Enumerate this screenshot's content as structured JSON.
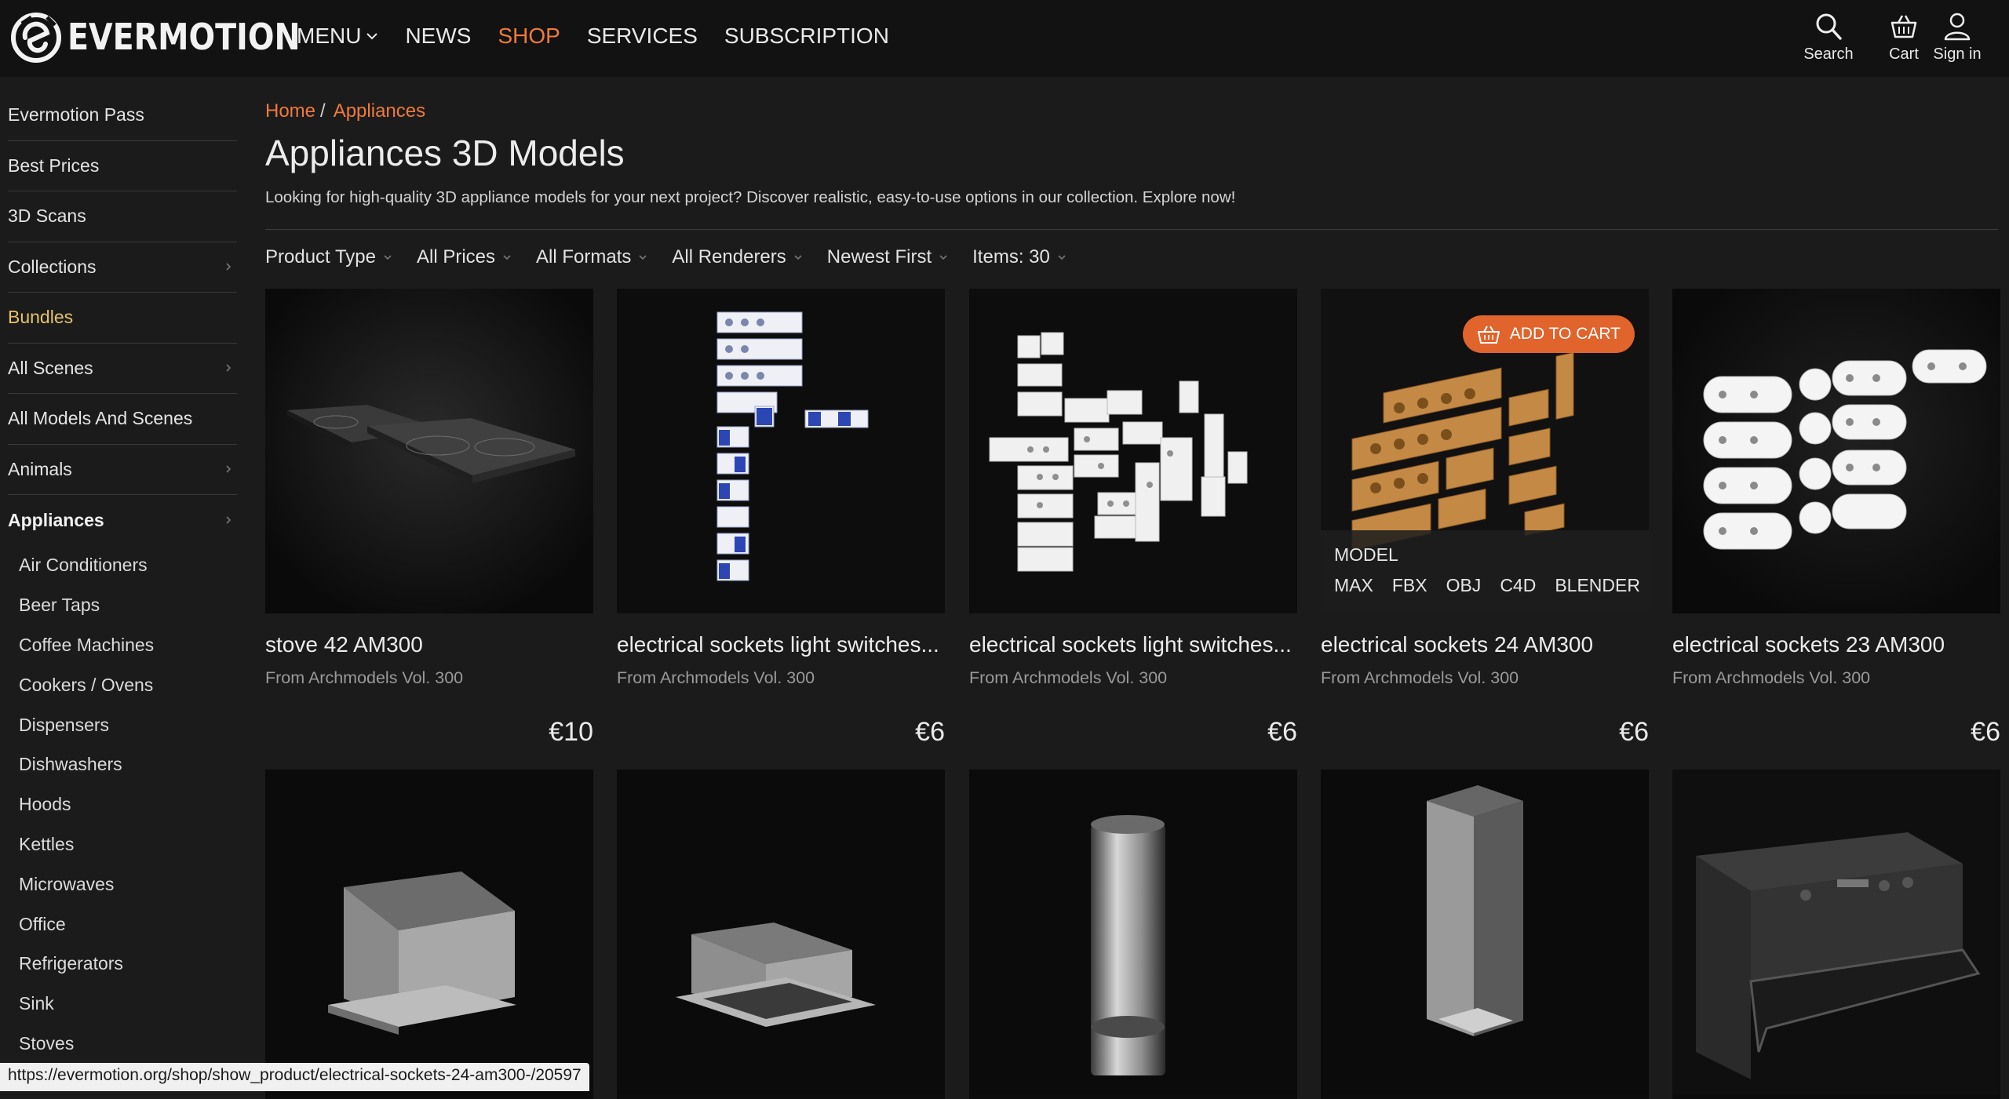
{
  "brand": {
    "name": "EVERMOTION"
  },
  "nav": {
    "items": [
      {
        "label": "MENU",
        "dropdown": true,
        "active": false
      },
      {
        "label": "NEWS",
        "active": false
      },
      {
        "label": "SHOP",
        "active": true
      },
      {
        "label": "SERVICES",
        "active": false
      },
      {
        "label": "SUBSCRIPTION",
        "active": false
      }
    ],
    "search_label": "Search",
    "cart_label": "Cart",
    "signin_label": "Sign in"
  },
  "sidebar": {
    "items": [
      {
        "label": "Evermotion Pass"
      },
      {
        "label": "Best Prices"
      },
      {
        "label": "3D Scans"
      },
      {
        "label": "Collections",
        "has_children": true
      },
      {
        "label": "Bundles",
        "highlight": true
      },
      {
        "label": "All Scenes",
        "has_children": true
      },
      {
        "label": "All Models And Scenes"
      },
      {
        "label": "Animals",
        "has_children": true
      },
      {
        "label": "Appliances",
        "has_children": true,
        "selected": true
      }
    ],
    "subcategories": [
      "Air Conditioners",
      "Beer Taps",
      "Coffee Machines",
      "Cookers / Ovens",
      "Dispensers",
      "Dishwashers",
      "Hoods",
      "Kettles",
      "Microwaves",
      "Office",
      "Refrigerators",
      "Sink",
      "Stoves"
    ]
  },
  "breadcrumb": {
    "home": "Home",
    "separator": "/",
    "current": "Appliances"
  },
  "page": {
    "title": "Appliances 3D Models",
    "description": "Looking for high-quality 3D appliance models for your next project? Discover realistic, easy-to-use options in our collection. Explore now!"
  },
  "filters": [
    "Product Type",
    "All Prices",
    "All Formats",
    "All Renderers",
    "Newest First",
    "Items: 30"
  ],
  "products": [
    {
      "title": "stove 42 AM300",
      "source": "From Archmodels Vol. 300",
      "price": "€10",
      "art": "stove"
    },
    {
      "title": "electrical sockets light switches...",
      "source": "From Archmodels Vol. 300",
      "price": "€6",
      "art": "switches-blue"
    },
    {
      "title": "electrical sockets light switches...",
      "source": "From Archmodels Vol. 300",
      "price": "€6",
      "art": "switches-white"
    },
    {
      "title": "electrical sockets 24 AM300",
      "source": "From Archmodels Vol. 300",
      "price": "€6",
      "art": "sockets-wood",
      "hover": {
        "add_to_cart": "ADD TO CART",
        "type": "MODEL",
        "formats": [
          "MAX",
          "FBX",
          "OBJ",
          "C4D",
          "BLENDER",
          "..."
        ]
      }
    },
    {
      "title": "electrical sockets 23 AM300",
      "source": "From Archmodels Vol. 300",
      "price": "€6",
      "art": "sockets-round"
    }
  ],
  "products_row2_art": [
    "hood-wall",
    "hood-canopy",
    "hood-cylinder",
    "hood-chimney",
    "oven"
  ],
  "status_url": "https://evermotion.org/shop/show_product/electrical-sockets-24-am300-/20597",
  "colors": {
    "accent": "#ef7a3a",
    "bundles": "#e5c36a",
    "add_to_cart": "#e0642c",
    "background": "#1b1b1c",
    "header": "#121212"
  }
}
